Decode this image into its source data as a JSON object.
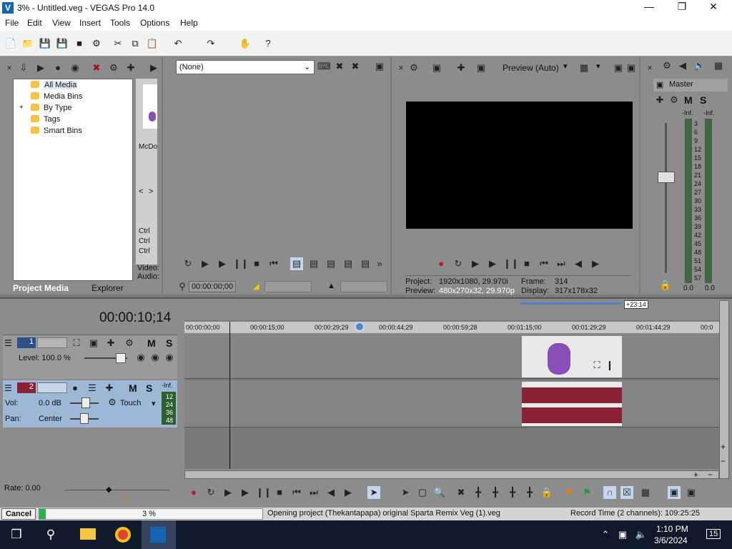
{
  "window": {
    "title": "3% - Untitled.veg - VEGAS Pro 14.0",
    "logo": "V"
  },
  "menu": [
    "File",
    "Edit",
    "View",
    "Insert",
    "Tools",
    "Options",
    "Help"
  ],
  "media_tree": {
    "items": [
      "All Media",
      "Media Bins",
      "By Type",
      "Tags",
      "Smart Bins"
    ],
    "expander": "+"
  },
  "thumb": {
    "label": "McDo",
    "nav_left": "<",
    "nav_right": ">",
    "ctrl": [
      "Ctrl",
      "Ctrl",
      "Ctrl"
    ],
    "video": "Video:",
    "audio": "Audio:"
  },
  "tabs": {
    "project_media": "Project Media",
    "explorer": "Explorer"
  },
  "trimmer": {
    "select": "(None)",
    "timecode": "00:00:00;00"
  },
  "preview": {
    "quality": "Preview (Auto)",
    "project_label": "Project:",
    "project_value": "1920x1080, 29.970i",
    "preview_label": "Preview:",
    "preview_value": "480x270x32, 29.970p",
    "frame_label": "Frame:",
    "frame_value": "314",
    "display_label": "Display:",
    "display_value": "317x178x32"
  },
  "master": {
    "title": "Master",
    "m": "M",
    "s": "S",
    "inf_l": "-Inf.",
    "inf_r": "-Inf.",
    "scale": [
      "3",
      "6",
      "9",
      "12",
      "15",
      "18",
      "21",
      "24",
      "27",
      "30",
      "33",
      "36",
      "39",
      "42",
      "45",
      "48",
      "51",
      "54",
      "57"
    ],
    "bottom_l": "0.0",
    "bottom_r": "0.0"
  },
  "timeline": {
    "timecode": "00:00:10;14",
    "offset": "+23:14",
    "ruler": [
      "00:00:00;00",
      "00:00:15;00",
      "00:00:29;29",
      "00:00:44;29",
      "00:00:59;28",
      "00:01:15;00",
      "00:01:29;29",
      "00:01:44;29",
      "00:0"
    ]
  },
  "track1": {
    "num": "1",
    "level": "Level: 100.0 %",
    "m": "M",
    "s": "S"
  },
  "track2": {
    "num": "2",
    "vol_label": "Vol:",
    "vol_value": "0.0 dB",
    "pan_label": "Pan:",
    "pan_value": "Center",
    "touch": "Touch",
    "m": "M",
    "s": "S",
    "inf": "-Inf.",
    "scale": [
      "12",
      "24",
      "36",
      "48"
    ]
  },
  "bottom": {
    "rate": "Rate: 0.00"
  },
  "status": {
    "cancel": "Cancel",
    "progress": 0.03,
    "percent": "3 %",
    "message": "Opening project (Thekantapapa) original Sparta Remix Veg (1).veg",
    "record": "Record Time (2 channels): 109:25:25"
  },
  "taskbar": {
    "time": "1:10 PM",
    "date": "3/6/2024",
    "notif": "15"
  },
  "colors": {
    "accent": "#1464b4",
    "wave": "#8b2234",
    "track_sel": "#9db7d6",
    "progress": "#26b34a"
  }
}
